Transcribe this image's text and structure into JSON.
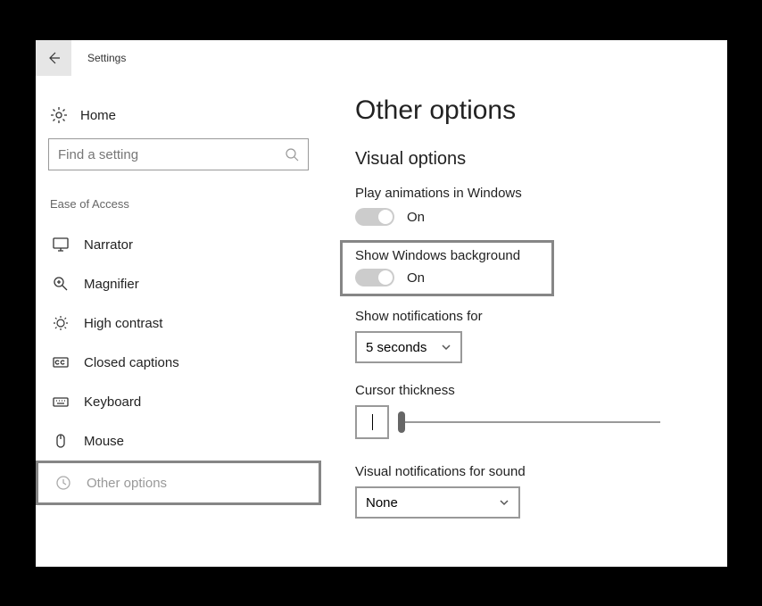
{
  "titlebar": {
    "title": "Settings"
  },
  "sidebar": {
    "home_label": "Home",
    "search_placeholder": "Find a setting",
    "section_label": "Ease of Access",
    "items": [
      {
        "label": "Narrator"
      },
      {
        "label": "Magnifier"
      },
      {
        "label": "High contrast"
      },
      {
        "label": "Closed captions"
      },
      {
        "label": "Keyboard"
      },
      {
        "label": "Mouse"
      },
      {
        "label": "Other options"
      }
    ]
  },
  "main": {
    "page_title": "Other options",
    "group_title": "Visual options",
    "play_animations": {
      "label": "Play animations in Windows",
      "state": "On"
    },
    "show_background": {
      "label": "Show Windows background",
      "state": "On"
    },
    "notifications": {
      "label": "Show notifications for",
      "value": "5 seconds"
    },
    "cursor_thickness": {
      "label": "Cursor thickness"
    },
    "visual_notifications": {
      "label": "Visual notifications for sound",
      "value": "None"
    }
  }
}
